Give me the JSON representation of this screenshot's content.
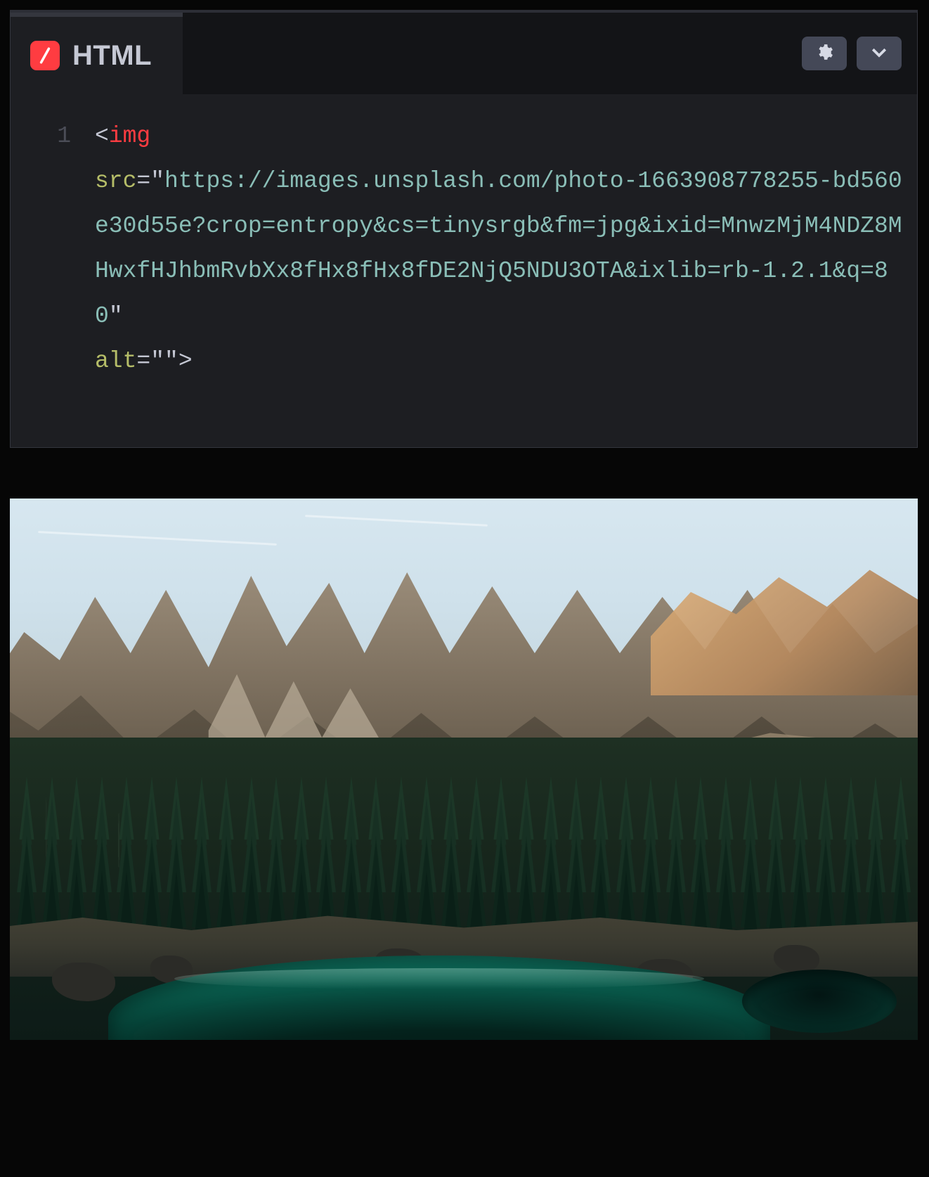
{
  "editor": {
    "tab_title": "HTML",
    "logo_icon": "slash-icon",
    "settings_icon": "gear-icon",
    "chevron_icon": "chevron-down-icon",
    "gutter": [
      "1"
    ],
    "code": {
      "tag_open": "<",
      "tag_name": "img",
      "attr_src_name": "src",
      "eq": "=",
      "quote": "\"",
      "src_value": "https://images.unsplash.com/photo-1663908778255-bd560e30d55e?crop=entropy&cs=tinysrgb&fm=jpg&ixid=MnwzMjM4NDZ8MHwxfHJhbmRvbXx8fHx8fHx8fDE2NjQ5NDU3OTA&ixlib=rb-1.2.1&q=80",
      "attr_alt_name": "alt",
      "alt_value": "",
      "tag_close": ">"
    }
  }
}
